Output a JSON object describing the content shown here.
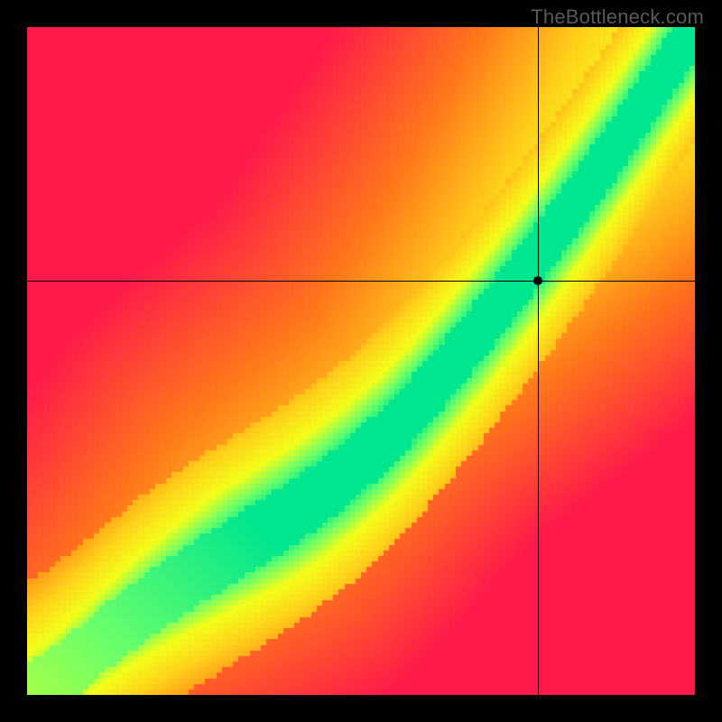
{
  "watermark": "TheBottleneck.com",
  "chart_data": {
    "type": "heatmap",
    "title": "",
    "xlabel": "",
    "ylabel": "",
    "xlim": [
      0,
      1
    ],
    "ylim": [
      0,
      1
    ],
    "grid": false,
    "description": "Continuous color field from red (worst) through orange/yellow to green (best) showing an optimal diagonal ridge; crosshair marks a sampled point.",
    "color_stops": [
      {
        "t": 0.0,
        "color": "#ff1a4b"
      },
      {
        "t": 0.35,
        "color": "#ff7a1a"
      },
      {
        "t": 0.6,
        "color": "#ffd21a"
      },
      {
        "t": 0.78,
        "color": "#f4ff1a"
      },
      {
        "t": 0.9,
        "color": "#6bff6b"
      },
      {
        "t": 1.0,
        "color": "#00e68e"
      }
    ],
    "ridge": {
      "comment": "Optimal green ridge y = f(x); piecewise-ish superlinear curve, slightly steeper than y=x in the upper half.",
      "exponent_low": 1.15,
      "exponent_high": 1.55,
      "blend_center": 0.35,
      "blend_width": 0.25,
      "band_halfwidth": 0.05,
      "yellow_halo": 0.12
    },
    "background_gradient": {
      "comment": "Far-field coloring: upper-left dominated red, lower-right dominated red, mid diagonal warm.",
      "corner_scores": {
        "bottom_left": 0.0,
        "bottom_right": 0.0,
        "top_left": 0.0,
        "top_right": 0.55
      }
    },
    "crosshair": {
      "x": 0.765,
      "y": 0.62
    },
    "marker": {
      "x": 0.765,
      "y": 0.62
    },
    "pixelation": 120
  }
}
